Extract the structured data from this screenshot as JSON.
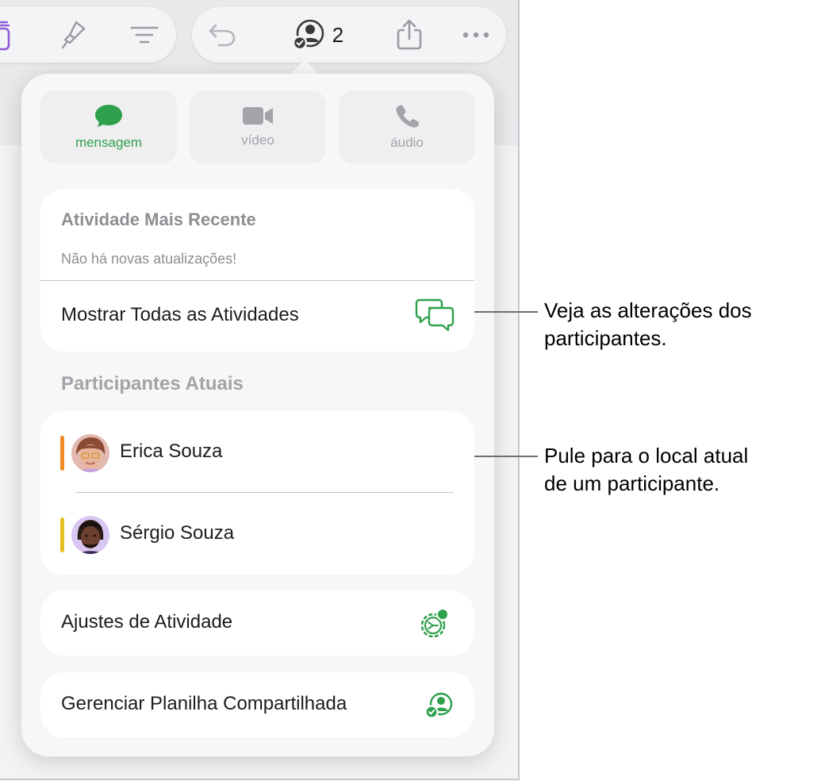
{
  "toolbar": {
    "collaborators_count": "2"
  },
  "comm_options": [
    {
      "label": "mensagem",
      "icon": "message-bubble-icon",
      "active": true
    },
    {
      "label": "vídeo",
      "icon": "video-camera-icon",
      "active": false
    },
    {
      "label": "áudio",
      "icon": "phone-icon",
      "active": false
    }
  ],
  "recent_activity": {
    "title": "Atividade Mais Recente",
    "subtitle": "Não há novas atualizações!",
    "show_all_label": "Mostrar Todas as Atividades"
  },
  "participants": {
    "heading": "Participantes Atuais",
    "list": [
      {
        "name": "Erica Souza",
        "color": "#f08a24"
      },
      {
        "name": "Sérgio Souza",
        "color": "#e4c021"
      }
    ]
  },
  "actions": {
    "activity_settings_label": "Ajustes de Atividade",
    "manage_sheet_label": "Gerenciar Planilha Compartilhada"
  },
  "callouts": {
    "activity_line1": "Veja as alterações dos",
    "activity_line2": "participantes.",
    "participant_line1": "Pule para o local atual",
    "participant_line2": "de um participante."
  },
  "colors": {
    "accent_green": "#2fa04c",
    "accent_purple": "#8e5bd6"
  }
}
